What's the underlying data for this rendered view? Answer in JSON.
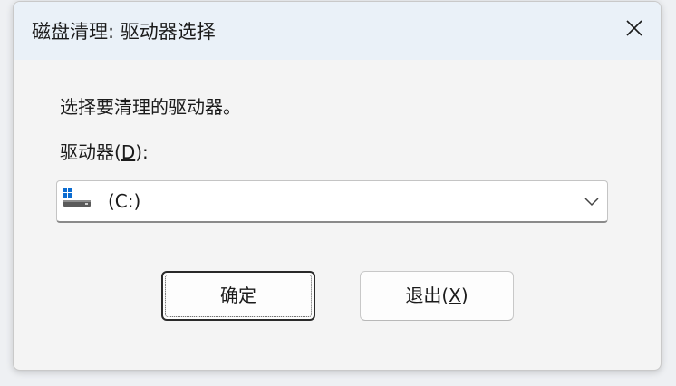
{
  "window": {
    "title": "磁盘清理: 驱动器选择"
  },
  "prompt": "选择要清理的驱动器。",
  "drive_field": {
    "label_prefix": "驱动器(",
    "label_mnemonic": "D",
    "label_suffix": "):",
    "selected_value": "(C:)",
    "icon": "drive-icon"
  },
  "buttons": {
    "ok_label": "确定",
    "exit_prefix": "退出(",
    "exit_mnemonic": "X",
    "exit_suffix": ")"
  },
  "colors": {
    "titlebar": "#eaf1f8",
    "body": "#f4f4f4",
    "drive_accent": "#0b6cd1"
  }
}
